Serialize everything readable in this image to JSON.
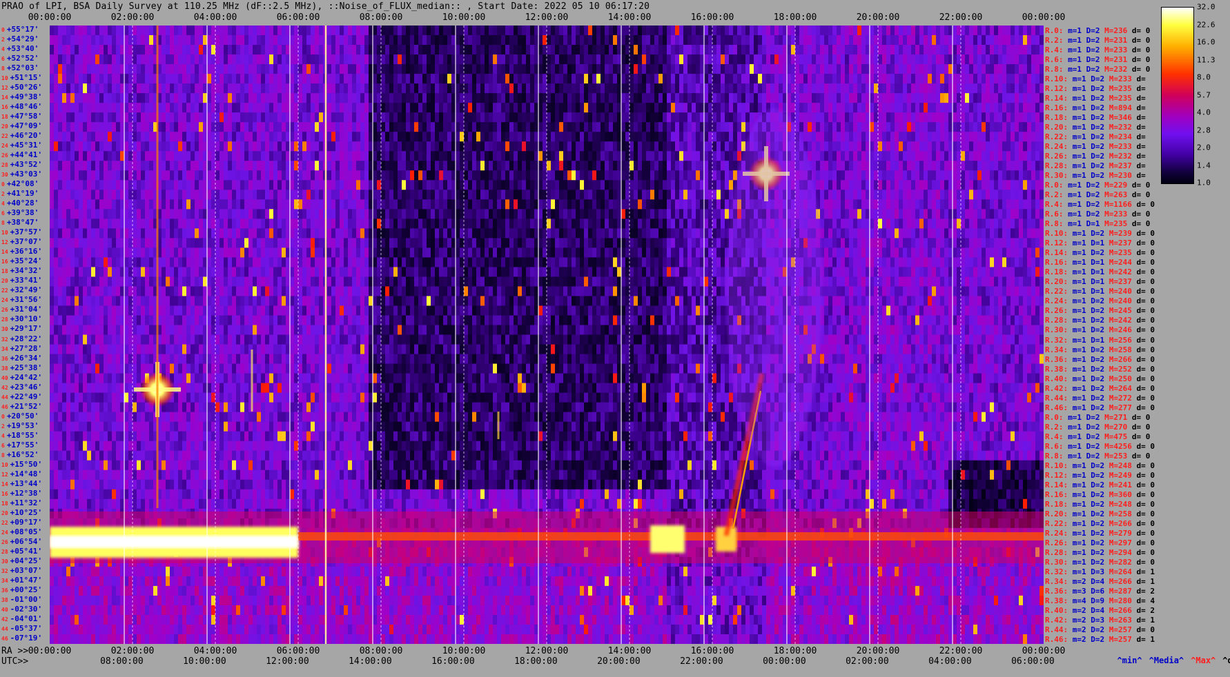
{
  "title": "PRAO of LPI, BSA Daily Survey at 110.25 MHz (dF::2.5 MHz), ::Noise_of_FLUX_median:: , Start Date: 2022 05 10 06:17:20",
  "top_axis_ticks": [
    "00:00:00",
    "02:00:00",
    "04:00:00",
    "06:00:00",
    "08:00:00",
    "10:00:00",
    "12:00:00",
    "14:00:00",
    "16:00:00",
    "18:00:00",
    "20:00:00",
    "22:00:00",
    "00:00:00"
  ],
  "ra_axis": {
    "prefix": "RA >>",
    "ticks": [
      "00:00:00",
      "02:00:00",
      "04:00:00",
      "06:00:00",
      "08:00:00",
      "10:00:00",
      "12:00:00",
      "14:00:00",
      "16:00:00",
      "18:00:00",
      "20:00:00",
      "22:00:00",
      "00:00:00"
    ]
  },
  "utc_axis": {
    "prefix": "UTC>>",
    "ticks": [
      "08:00:00",
      "10:00:00",
      "12:00:00",
      "14:00:00",
      "16:00:00",
      "18:00:00",
      "20:00:00",
      "22:00:00",
      "00:00:00",
      "02:00:00",
      "04:00:00",
      "06:00:00"
    ]
  },
  "declinations": [
    {
      "i": "0",
      "d": "+55°17'"
    },
    {
      "i": "2",
      "d": "+54°29'"
    },
    {
      "i": "4",
      "d": "+53°40'"
    },
    {
      "i": "6",
      "d": "+52°52'"
    },
    {
      "i": "8",
      "d": "+52°03'"
    },
    {
      "i": "10",
      "d": "+51°15'"
    },
    {
      "i": "12",
      "d": "+50°26'"
    },
    {
      "i": "14",
      "d": "+49°38'"
    },
    {
      "i": "16",
      "d": "+48°46'"
    },
    {
      "i": "18",
      "d": "+47°58'"
    },
    {
      "i": "20",
      "d": "+47°09'"
    },
    {
      "i": "22",
      "d": "+46°20'"
    },
    {
      "i": "24",
      "d": "+45°31'"
    },
    {
      "i": "26",
      "d": "+44°41'"
    },
    {
      "i": "28",
      "d": "+43°52'"
    },
    {
      "i": "30",
      "d": "+43°03'"
    },
    {
      "i": "0",
      "d": "+42°08'"
    },
    {
      "i": "2",
      "d": "+41°19'"
    },
    {
      "i": "4",
      "d": "+40°28'"
    },
    {
      "i": "6",
      "d": "+39°38'"
    },
    {
      "i": "8",
      "d": "+38°47'"
    },
    {
      "i": "10",
      "d": "+37°57'"
    },
    {
      "i": "12",
      "d": "+37°07'"
    },
    {
      "i": "14",
      "d": "+36°16'"
    },
    {
      "i": "16",
      "d": "+35°24'"
    },
    {
      "i": "18",
      "d": "+34°32'"
    },
    {
      "i": "20",
      "d": "+33°41'"
    },
    {
      "i": "22",
      "d": "+32°49'"
    },
    {
      "i": "24",
      "d": "+31°56'"
    },
    {
      "i": "26",
      "d": "+31°04'"
    },
    {
      "i": "28",
      "d": "+30°10'"
    },
    {
      "i": "30",
      "d": "+29°17'"
    },
    {
      "i": "32",
      "d": "+28°22'"
    },
    {
      "i": "34",
      "d": "+27°28'"
    },
    {
      "i": "36",
      "d": "+26°34'"
    },
    {
      "i": "38",
      "d": "+25°38'"
    },
    {
      "i": "40",
      "d": "+24°42'"
    },
    {
      "i": "42",
      "d": "+23°46'"
    },
    {
      "i": "44",
      "d": "+22°49'"
    },
    {
      "i": "46",
      "d": "+21°52'"
    },
    {
      "i": "0",
      "d": "+20°50'"
    },
    {
      "i": "2",
      "d": "+19°53'"
    },
    {
      "i": "4",
      "d": "+18°55'"
    },
    {
      "i": "6",
      "d": "+17°55'"
    },
    {
      "i": "8",
      "d": "+16°52'"
    },
    {
      "i": "10",
      "d": "+15°50'"
    },
    {
      "i": "12",
      "d": "+14°48'"
    },
    {
      "i": "14",
      "d": "+13°44'"
    },
    {
      "i": "16",
      "d": "+12°38'"
    },
    {
      "i": "18",
      "d": "+11°32'"
    },
    {
      "i": "20",
      "d": "+10°25'"
    },
    {
      "i": "22",
      "d": "+09°17'"
    },
    {
      "i": "24",
      "d": "+08°05'"
    },
    {
      "i": "26",
      "d": "+06°54'"
    },
    {
      "i": "28",
      "d": "+05°41'"
    },
    {
      "i": "30",
      "d": "+04°25'"
    },
    {
      "i": "32",
      "d": "+03°07'"
    },
    {
      "i": "34",
      "d": "+01°47'"
    },
    {
      "i": "36",
      "d": "+00°25'"
    },
    {
      "i": "38",
      "d": "-01°00'"
    },
    {
      "i": "40",
      "d": "-02°30'"
    },
    {
      "i": "42",
      "d": "-04°01'"
    },
    {
      "i": "44",
      "d": "-05°37'"
    },
    {
      "i": "46",
      "d": "-07°19'"
    }
  ],
  "beams": [
    {
      "n": "R.0:",
      "m": "m=1",
      "D": "D=2",
      "M": "M=236",
      "d": "d= 0"
    },
    {
      "n": "R.2:",
      "m": "m=1",
      "D": "D=2",
      "M": "M=231",
      "d": "d= 0"
    },
    {
      "n": "R.4:",
      "m": "m=1",
      "D": "D=2",
      "M": "M=233",
      "d": "d= 0"
    },
    {
      "n": "R.6:",
      "m": "m=1",
      "D": "D=2",
      "M": "M=231",
      "d": "d= 0"
    },
    {
      "n": "R.8:",
      "m": "m=1",
      "D": "D=2",
      "M": "M=232",
      "d": "d= 0"
    },
    {
      "n": "R.10:",
      "m": "m=1",
      "D": "D=2",
      "M": "M=233",
      "d": "d="
    },
    {
      "n": "R.12:",
      "m": "m=1",
      "D": "D=2",
      "M": "M=235",
      "d": "d="
    },
    {
      "n": "R.14:",
      "m": "m=1",
      "D": "D=2",
      "M": "M=235",
      "d": "d="
    },
    {
      "n": "R.16:",
      "m": "m=1",
      "D": "D=2",
      "M": "M=894",
      "d": "d="
    },
    {
      "n": "R.18:",
      "m": "m=1",
      "D": "D=2",
      "M": "M=346",
      "d": "d="
    },
    {
      "n": "R.20:",
      "m": "m=1",
      "D": "D=2",
      "M": "M=232",
      "d": "d="
    },
    {
      "n": "R.22:",
      "m": "m=1",
      "D": "D=2",
      "M": "M=234",
      "d": "d="
    },
    {
      "n": "R.24:",
      "m": "m=1",
      "D": "D=2",
      "M": "M=233",
      "d": "d="
    },
    {
      "n": "R.26:",
      "m": "m=1",
      "D": "D=2",
      "M": "M=232",
      "d": "d="
    },
    {
      "n": "R.28:",
      "m": "m=1",
      "D": "D=2",
      "M": "M=237",
      "d": "d="
    },
    {
      "n": "R.30:",
      "m": "m=1",
      "D": "D=2",
      "M": "M=230",
      "d": "d="
    },
    {
      "n": "R.0:",
      "m": "m=1",
      "D": "D=2",
      "M": "M=229",
      "d": "d= 0"
    },
    {
      "n": "R.2:",
      "m": "m=1",
      "D": "D=2",
      "M": "M=263",
      "d": "d= 0"
    },
    {
      "n": "R.4:",
      "m": "m=1",
      "D": "D=2",
      "M": "M=1166",
      "d": "d= 0"
    },
    {
      "n": "R.6:",
      "m": "m=1",
      "D": "D=2",
      "M": "M=233",
      "d": "d= 0"
    },
    {
      "n": "R.8:",
      "m": "m=1",
      "D": "D=1",
      "M": "M=235",
      "d": "d= 0"
    },
    {
      "n": "R.10:",
      "m": "m=1",
      "D": "D=2",
      "M": "M=239",
      "d": "d= 0"
    },
    {
      "n": "R.12:",
      "m": "m=1",
      "D": "D=1",
      "M": "M=237",
      "d": "d= 0"
    },
    {
      "n": "R.14:",
      "m": "m=1",
      "D": "D=2",
      "M": "M=235",
      "d": "d= 0"
    },
    {
      "n": "R.16:",
      "m": "m=1",
      "D": "D=1",
      "M": "M=244",
      "d": "d= 0"
    },
    {
      "n": "R.18:",
      "m": "m=1",
      "D": "D=1",
      "M": "M=242",
      "d": "d= 0"
    },
    {
      "n": "R.20:",
      "m": "m=1",
      "D": "D=1",
      "M": "M=237",
      "d": "d= 0"
    },
    {
      "n": "R.22:",
      "m": "m=1",
      "D": "D=1",
      "M": "M=240",
      "d": "d= 0"
    },
    {
      "n": "R.24:",
      "m": "m=1",
      "D": "D=2",
      "M": "M=240",
      "d": "d= 0"
    },
    {
      "n": "R.26:",
      "m": "m=1",
      "D": "D=2",
      "M": "M=245",
      "d": "d= 0"
    },
    {
      "n": "R.28:",
      "m": "m=1",
      "D": "D=2",
      "M": "M=242",
      "d": "d= 0"
    },
    {
      "n": "R.30:",
      "m": "m=1",
      "D": "D=2",
      "M": "M=246",
      "d": "d= 0"
    },
    {
      "n": "R.32:",
      "m": "m=1",
      "D": "D=1",
      "M": "M=256",
      "d": "d= 0"
    },
    {
      "n": "R.34:",
      "m": "m=1",
      "D": "D=2",
      "M": "M=258",
      "d": "d= 0"
    },
    {
      "n": "R.36:",
      "m": "m=1",
      "D": "D=2",
      "M": "M=266",
      "d": "d= 0"
    },
    {
      "n": "R.38:",
      "m": "m=1",
      "D": "D=2",
      "M": "M=252",
      "d": "d= 0"
    },
    {
      "n": "R.40:",
      "m": "m=1",
      "D": "D=2",
      "M": "M=250",
      "d": "d= 0"
    },
    {
      "n": "R.42:",
      "m": "m=1",
      "D": "D=2",
      "M": "M=264",
      "d": "d= 0"
    },
    {
      "n": "R.44:",
      "m": "m=1",
      "D": "D=2",
      "M": "M=272",
      "d": "d= 0"
    },
    {
      "n": "R.46:",
      "m": "m=1",
      "D": "D=2",
      "M": "M=277",
      "d": "d= 0"
    },
    {
      "n": "R.0:",
      "m": "m=1",
      "D": "D=2",
      "M": "M=271",
      "d": "d= 0"
    },
    {
      "n": "R.2:",
      "m": "m=1",
      "D": "D=2",
      "M": "M=270",
      "d": "d= 0"
    },
    {
      "n": "R.4:",
      "m": "m=1",
      "D": "D=2",
      "M": "M=475",
      "d": "d= 0"
    },
    {
      "n": "R.6:",
      "m": "m=1",
      "D": "D=2",
      "M": "M=4256",
      "d": "d= 0"
    },
    {
      "n": "R.8:",
      "m": "m=1",
      "D": "D=2",
      "M": "M=253",
      "d": "d= 0"
    },
    {
      "n": "R.10:",
      "m": "m=1",
      "D": "D=2",
      "M": "M=248",
      "d": "d= 0"
    },
    {
      "n": "R.12:",
      "m": "m=1",
      "D": "D=2",
      "M": "M=249",
      "d": "d= 0"
    },
    {
      "n": "R.14:",
      "m": "m=1",
      "D": "D=2",
      "M": "M=241",
      "d": "d= 0"
    },
    {
      "n": "R.16:",
      "m": "m=1",
      "D": "D=2",
      "M": "M=360",
      "d": "d= 0"
    },
    {
      "n": "R.18:",
      "m": "m=1",
      "D": "D=2",
      "M": "M=248",
      "d": "d= 0"
    },
    {
      "n": "R.20:",
      "m": "m=1",
      "D": "D=2",
      "M": "M=258",
      "d": "d= 0"
    },
    {
      "n": "R.22:",
      "m": "m=1",
      "D": "D=2",
      "M": "M=266",
      "d": "d= 0"
    },
    {
      "n": "R.24:",
      "m": "m=1",
      "D": "D=2",
      "M": "M=279",
      "d": "d= 0"
    },
    {
      "n": "R.26:",
      "m": "m=1",
      "D": "D=2",
      "M": "M=297",
      "d": "d= 0"
    },
    {
      "n": "R.28:",
      "m": "m=1",
      "D": "D=2",
      "M": "M=294",
      "d": "d= 0"
    },
    {
      "n": "R.30:",
      "m": "m=1",
      "D": "D=2",
      "M": "M=282",
      "d": "d= 0"
    },
    {
      "n": "R.32:",
      "m": "m=1",
      "D": "D=3",
      "M": "M=264",
      "d": "d= 1"
    },
    {
      "n": "R.34:",
      "m": "m=2",
      "D": "D=4",
      "M": "M=266",
      "d": "d= 1"
    },
    {
      "n": "R.36:",
      "m": "m=3",
      "D": "D=6",
      "M": "M=287",
      "d": "d= 2"
    },
    {
      "n": "R.38:",
      "m": "m=4",
      "D": "D=9",
      "M": "M=280",
      "d": "d= 4"
    },
    {
      "n": "R.40:",
      "m": "m=2",
      "D": "D=4",
      "M": "M=266",
      "d": "d= 2"
    },
    {
      "n": "R.42:",
      "m": "m=2",
      "D": "D=3",
      "M": "M=263",
      "d": "d= 1"
    },
    {
      "n": "R.44:",
      "m": "m=2",
      "D": "D=2",
      "M": "M=257",
      "d": "d= 0"
    },
    {
      "n": "R.46:",
      "m": "m=2",
      "D": "D=2",
      "M": "M=257",
      "d": "d= 1"
    }
  ],
  "footer_legend": {
    "min": "^min^",
    "median": "^Media^",
    "max": "^Max^",
    "devia": "^devia^"
  },
  "colorbar": {
    "labels": [
      "32.0",
      "22.6",
      "16.0",
      "11.3",
      "8.0",
      "5.7",
      "4.0",
      "2.8",
      "2.0",
      "1.4",
      "1.0"
    ]
  },
  "chart_data": {
    "type": "heatmap",
    "title": "PRAO of LPI, BSA Daily Survey at 110.25 MHz (dF::2.5 MHz), ::Noise_of_FLUX_median:: , Start Date: 2022 05 10 06:17:20",
    "x_axis": "RA 00:00:00 to 24:00:00 (2 h ticks); UTC 06:17:20 start",
    "y_axis": "Declination +55°17' to -07°19' (64 beams)",
    "value_range": [
      1.0,
      32.0
    ],
    "color_scale": "log, black-purple-red-yellow-white",
    "features": [
      {
        "name": "bright source",
        "ra_hours": 3.1,
        "dec_deg": 17.9,
        "level": 32
      },
      {
        "name": "bright source",
        "ra_hours": 19.9,
        "dec_deg": 40.5,
        "level": 32
      },
      {
        "name": "strong interference band",
        "ra_hours": [
          0,
          7.0
        ],
        "dec_deg": [
          -4,
          2
        ],
        "level": 32
      }
    ]
  }
}
